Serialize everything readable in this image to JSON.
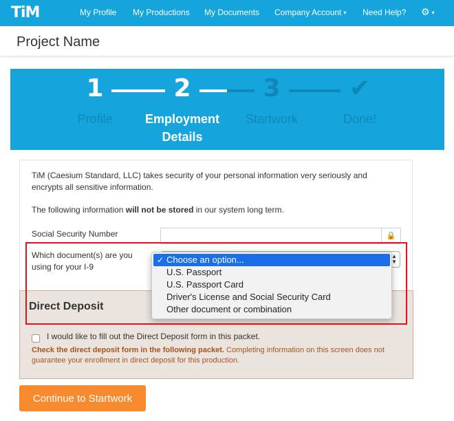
{
  "nav": {
    "logo": "TiM",
    "items": [
      "My Profile",
      "My Productions",
      "My Documents",
      "Company Account",
      "Need Help?"
    ],
    "caret": "▾",
    "settings_icon": "⚙"
  },
  "page": {
    "title": "Project Name"
  },
  "steps": [
    {
      "number": "1",
      "label": "Profile",
      "state": "done"
    },
    {
      "number": "2",
      "label_line1": "Employment",
      "label_line2": "Details",
      "state": "current"
    },
    {
      "number": "3",
      "label": "Startwork",
      "state": "upcoming"
    },
    {
      "number": "✔",
      "label": "Done!",
      "state": "upcoming"
    }
  ],
  "form": {
    "intro_line1": "TiM (Caesium Standard, LLC) takes security of your personal information very seriously and",
    "intro_line2": "encrypts all sensitive information.",
    "storage_pre": "The following information ",
    "storage_bold": "will not be stored",
    "storage_post": " in our system long term.",
    "ssn_label": "Social Security Number",
    "ssn_value": "",
    "lock_icon": "🔒",
    "doc_label_line1": "Which document(s) are you",
    "doc_label_line2": "using for your I-9",
    "doc_select": {
      "selected": "Choose an option...",
      "options": [
        "Choose an option...",
        "U.S. Passport",
        "U.S. Passport Card",
        "Driver's License and Social Security Card",
        "Other document or combination"
      ]
    }
  },
  "deposit": {
    "title": "Direct Deposit",
    "checkbox_label": "I would like to fill out the Direct Deposit form in this packet.",
    "checked": false,
    "note_bold": "Check the direct deposit form in the following packet.",
    "note_rest": " Completing information on this screen does not guarantee your enrollment in direct deposit for this production."
  },
  "continue_label": "Continue to Startwork",
  "colors": {
    "brand_blue": "#16a4dd",
    "orange": "#f7892e",
    "highlight_red": "#e0131c",
    "select_blue": "#1a6fe8"
  }
}
